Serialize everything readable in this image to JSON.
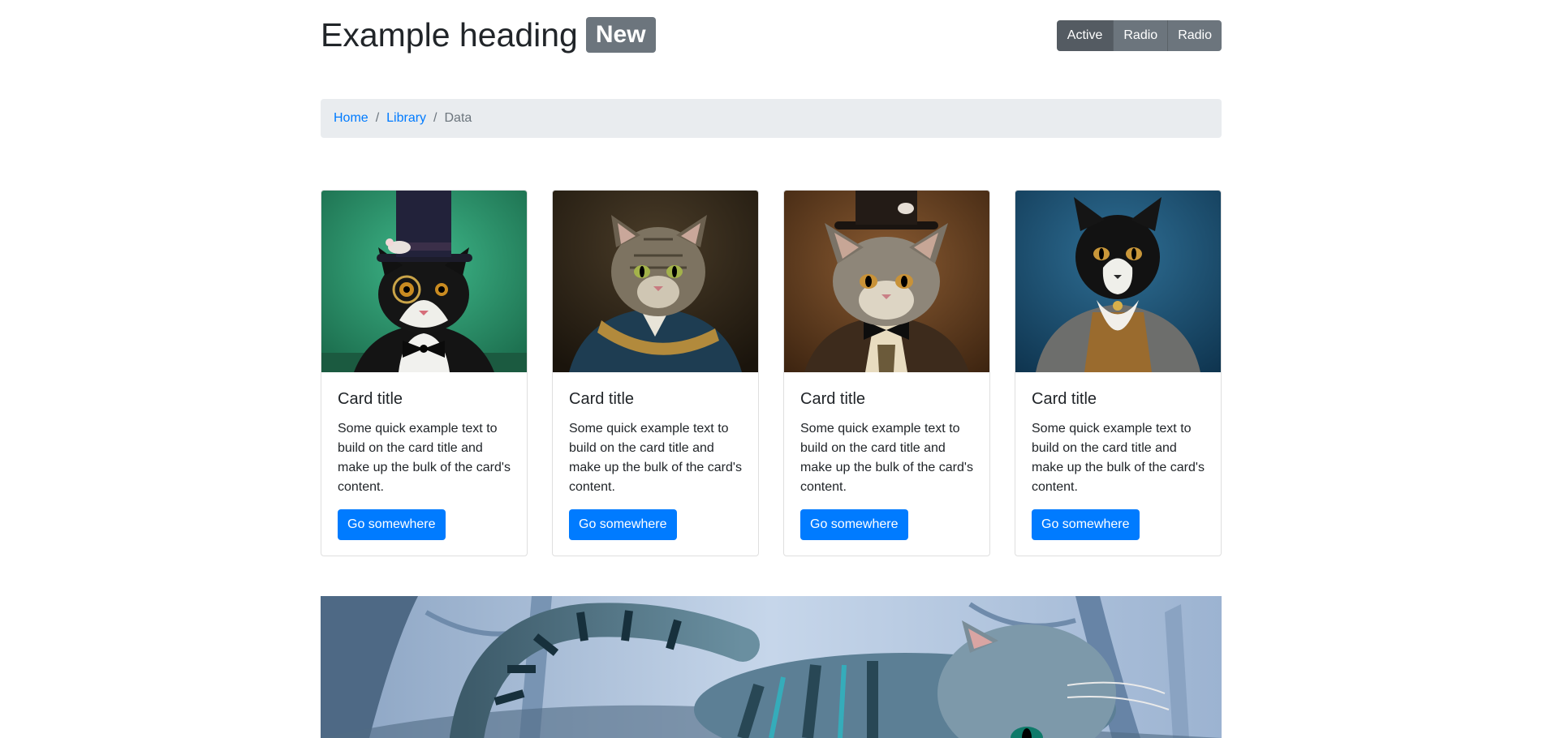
{
  "header": {
    "title": "Example heading",
    "badge": "New",
    "toggle": [
      "Active",
      "Radio",
      "Radio"
    ]
  },
  "breadcrumb": {
    "items": [
      "Home",
      "Library",
      "Data"
    ]
  },
  "cards": [
    {
      "title": "Card title",
      "text": "Some quick example text to build on the card title and make up the bulk of the card's content.",
      "button": "Go somewhere"
    },
    {
      "title": "Card title",
      "text": "Some quick example text to build on the card title and make up the bulk of the card's content.",
      "button": "Go somewhere"
    },
    {
      "title": "Card title",
      "text": "Some quick example text to build on the card title and make up the bulk of the card's content.",
      "button": "Go somewhere"
    },
    {
      "title": "Card title",
      "text": "Some quick example text to build on the card title and make up the bulk of the card's content.",
      "button": "Go somewhere"
    }
  ],
  "colors": {
    "primary": "#007bff",
    "secondary": "#6c757d",
    "breadcrumb_bg": "#e9ecef"
  }
}
